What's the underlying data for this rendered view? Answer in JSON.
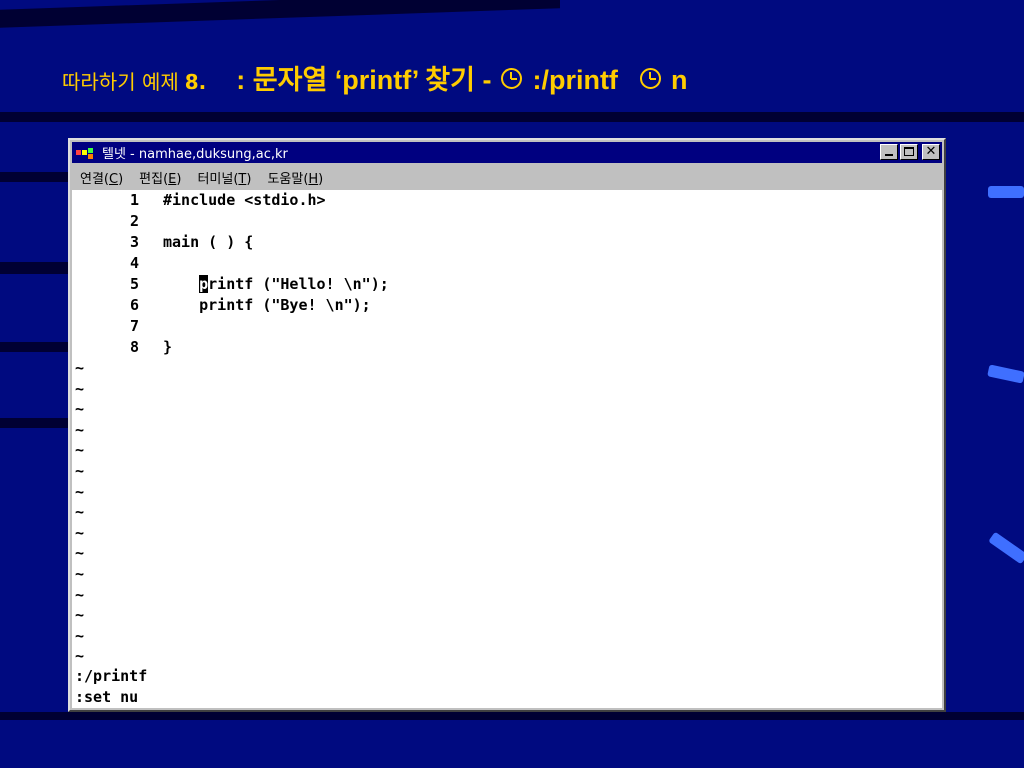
{
  "slide": {
    "title_prefix": "따라하기 예제",
    "title_number": "8.",
    "title_main": ": 문자열 ‘printf’ 찾기 -",
    "title_mid": ":/printf",
    "title_tail": "n"
  },
  "window": {
    "title": "텔넷 - namhae,duksung,ac,kr",
    "menus": [
      {
        "label": "연결(",
        "key": "C",
        "end": ")"
      },
      {
        "label": "편집(",
        "key": "E",
        "end": ")"
      },
      {
        "label": "터미널(",
        "key": "T",
        "end": ")"
      },
      {
        "label": "도움말(",
        "key": "H",
        "end": ")"
      }
    ]
  },
  "editor": {
    "lines": [
      {
        "num": "1",
        "text": "#include <stdio.h>"
      },
      {
        "num": "2",
        "text": ""
      },
      {
        "num": "3",
        "text": "main ( ) {"
      },
      {
        "num": "4",
        "text": ""
      },
      {
        "num": "5",
        "cursor": "p",
        "text": "rintf (\"Hello! \\n\");"
      },
      {
        "num": "6",
        "text": "    printf (\"Bye! \\n\");"
      },
      {
        "num": "7",
        "text": ""
      },
      {
        "num": "8",
        "text": "}"
      }
    ],
    "indent5": "    ",
    "tilde": "~",
    "commands": [
      ":/printf",
      ":set nu"
    ]
  },
  "colors": {
    "background": "#000a80",
    "title_text": "#ffcc00",
    "titlebar": "#000080",
    "window_face": "#c0c0c0"
  }
}
